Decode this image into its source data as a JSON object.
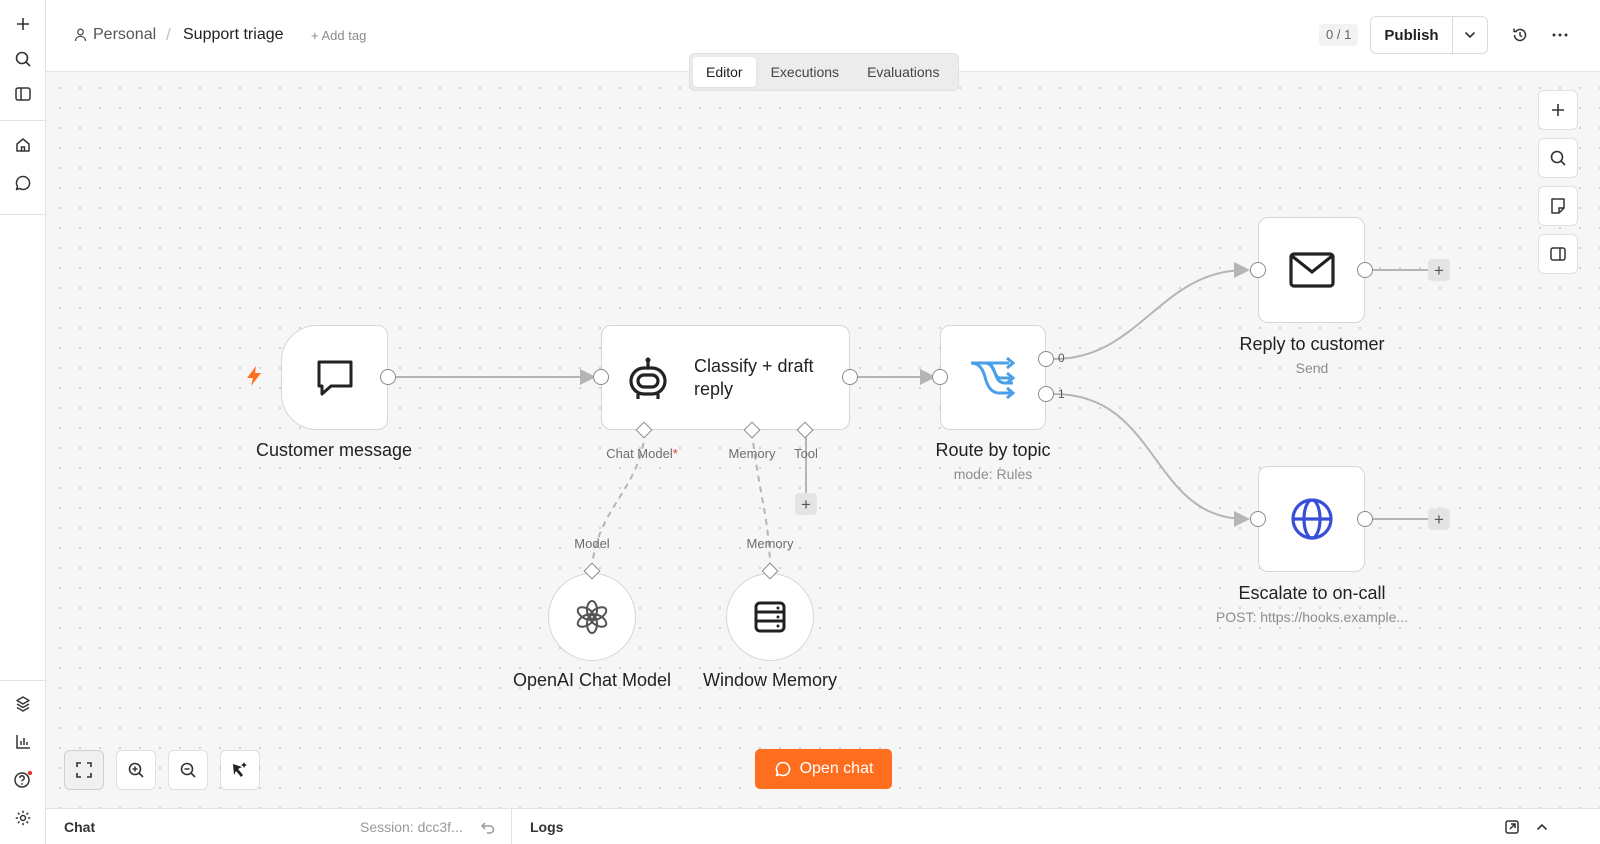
{
  "rail": {
    "top_icons": [
      "plus-icon",
      "search-icon",
      "sidebar-toggle-icon",
      "home-icon",
      "chat-icon"
    ],
    "bottom_icons": [
      "templates-icon",
      "insights-icon",
      "help-icon",
      "settings-icon"
    ],
    "help_notification_color": "#e0392b"
  },
  "header": {
    "project": "Personal",
    "separator": "/",
    "workflow_name": "Support triage",
    "add_tag": "+ Add tag",
    "counter": "0 / 1",
    "publish_label": "Publish",
    "icons": [
      "chevron-down-icon",
      "history-icon",
      "more-icon"
    ]
  },
  "tabs": [
    {
      "label": "Editor",
      "active": true
    },
    {
      "label": "Executions",
      "active": false
    },
    {
      "label": "Evaluations",
      "active": false
    }
  ],
  "right_tools": [
    "add-node-icon",
    "search-nodes-icon",
    "sticky-note-icon",
    "panel-toggle-icon"
  ],
  "nodes": {
    "trigger": {
      "label": "Customer message",
      "icon": "message-bubble-icon",
      "trigger_icon_color": "#ff6d1f"
    },
    "agent": {
      "label": "Classify + draft reply",
      "icon": "robot-icon",
      "ports": {
        "chat_model": "Chat Model",
        "chat_model_required": "*",
        "memory": "Memory",
        "tool": "Tool"
      }
    },
    "router": {
      "label": "Route by topic",
      "sub": "mode: Rules",
      "icon": "switch-branch-icon",
      "icon_color": "#4a9fe8",
      "outputs": [
        "0",
        "1"
      ]
    },
    "reply": {
      "label": "Reply to customer",
      "sub": "Send",
      "icon": "mail-icon"
    },
    "escalate": {
      "label": "Escalate to on-call",
      "sub": "POST: https://hooks.example...",
      "icon": "globe-icon",
      "icon_color": "#3a4fd8"
    },
    "model": {
      "label": "OpenAI Chat Model",
      "port": "Model",
      "icon": "openai-icon"
    },
    "memory": {
      "label": "Window Memory",
      "port": "Memory",
      "icon": "database-icon"
    }
  },
  "zoom_tools": [
    "fit-view-icon",
    "zoom-in-icon",
    "zoom-out-icon",
    "tidy-up-icon"
  ],
  "open_chat": {
    "label": "Open chat",
    "color": "#ff6d1f"
  },
  "bottom": {
    "chat": "Chat",
    "session": "Session: dcc3f...",
    "logs": "Logs"
  }
}
